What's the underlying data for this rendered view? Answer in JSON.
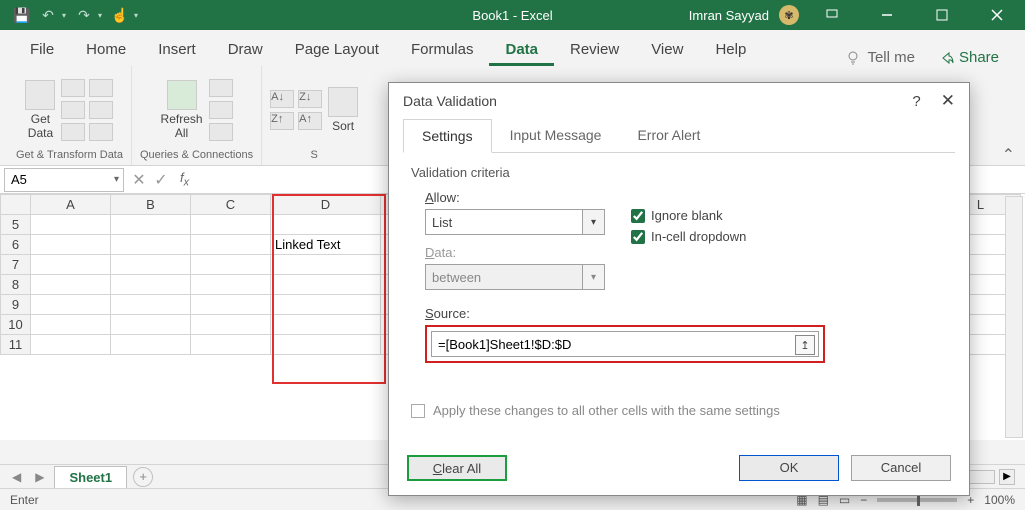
{
  "titlebar": {
    "doc_title": "Book1 - Excel",
    "user_name": "Imran Sayyad"
  },
  "ribbon_tabs": [
    "File",
    "Home",
    "Insert",
    "Draw",
    "Page Layout",
    "Formulas",
    "Data",
    "Review",
    "View",
    "Help"
  ],
  "active_tab": "Data",
  "tell_me_label": "Tell me",
  "share_label": "Share",
  "ribbon": {
    "group1_label": "Get & Transform Data",
    "get_data_label": "Get\nData",
    "group2_label": "Queries & Connections",
    "refresh_label": "Refresh\nAll",
    "sort_label": "Sort"
  },
  "name_box_value": "A5",
  "grid": {
    "columns": [
      "A",
      "B",
      "C",
      "D"
    ],
    "extra_col": "L",
    "rows": [
      "5",
      "6",
      "7",
      "8",
      "9",
      "10",
      "11"
    ],
    "d6_value": "Linked Text"
  },
  "sheet_tab_label": "Sheet1",
  "status_text": "Enter",
  "zoom_label": "100%",
  "dialog": {
    "title": "Data Validation",
    "tabs": [
      "Settings",
      "Input Message",
      "Error Alert"
    ],
    "active_tab": "Settings",
    "criteria_label": "Validation criteria",
    "allow_label_pre": "A",
    "allow_label_post": "llow:",
    "allow_value": "List",
    "data_label_pre": "D",
    "data_label_post": "ata:",
    "data_value": "between",
    "ignore_blank_label_pre": "Ignore ",
    "ignore_blank_label_u": "b",
    "ignore_blank_label_post": "lank",
    "incell_label_pre": "I",
    "incell_label_post": "n-cell dropdown",
    "source_label_pre": "S",
    "source_label_post": "ource:",
    "source_value": "=[Book1]Sheet1!$D:$D",
    "apply_label": "Apply these changes to all other cells with the same settings",
    "clear_all_label": "Clear All",
    "ok_label": "OK",
    "cancel_label": "Cancel"
  }
}
